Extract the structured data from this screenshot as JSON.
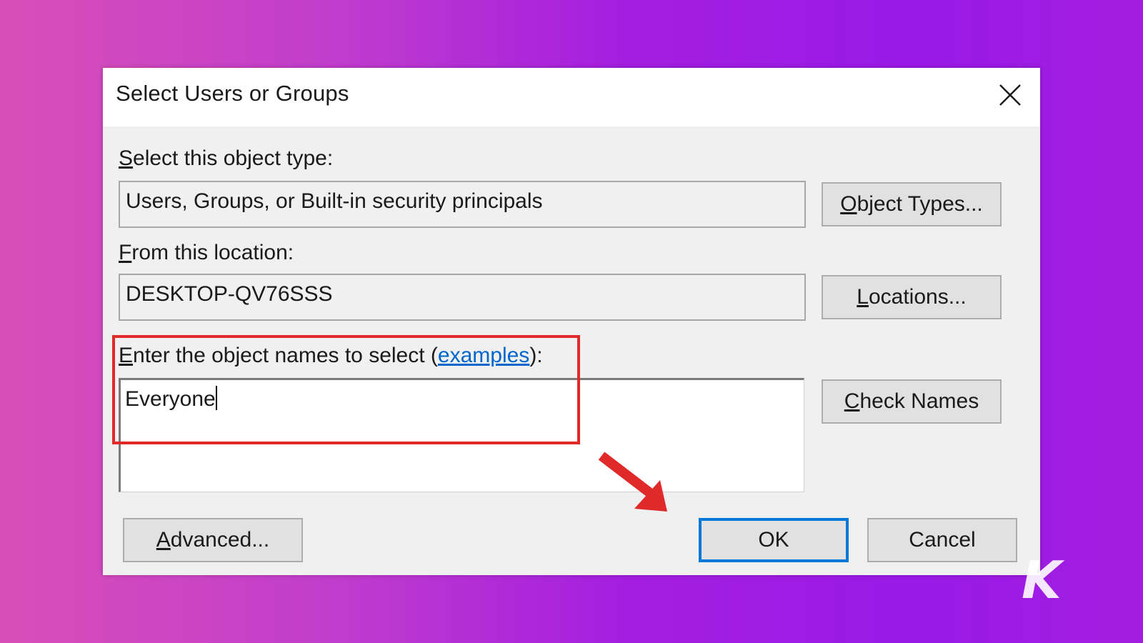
{
  "dialog": {
    "title": "Select Users or Groups",
    "close_icon": "close-icon"
  },
  "object_type": {
    "label_prefix": "",
    "label_accel": "S",
    "label_rest": "elect this object type:",
    "value": "Users, Groups, or Built-in security principals",
    "button_accel": "O",
    "button_rest": "bject Types..."
  },
  "location": {
    "label_accel": "F",
    "label_rest": "rom this location:",
    "value": "DESKTOP-QV76SSS",
    "button_accel": "L",
    "button_rest": "ocations..."
  },
  "object_names": {
    "label_accel": "E",
    "label_rest": "nter the object names to select (",
    "link_text": "examples",
    "label_end": "):",
    "value": "Everyone",
    "check_button_accel": "C",
    "check_button_rest": "heck Names"
  },
  "footer": {
    "advanced_accel": "A",
    "advanced_rest": "dvanced...",
    "ok_label": "OK",
    "cancel_label": "Cancel"
  },
  "annotations": {
    "highlight_color": "#e02a2a",
    "arrow_color": "#e02a2a"
  },
  "watermark": {
    "logo_icon": "knowtechie-k-logo",
    "text": "K"
  },
  "colors": {
    "background_left": "#d94fb8",
    "background_right": "#9a1ae6",
    "default_button_border": "#0078d7",
    "link": "#0066cc"
  }
}
